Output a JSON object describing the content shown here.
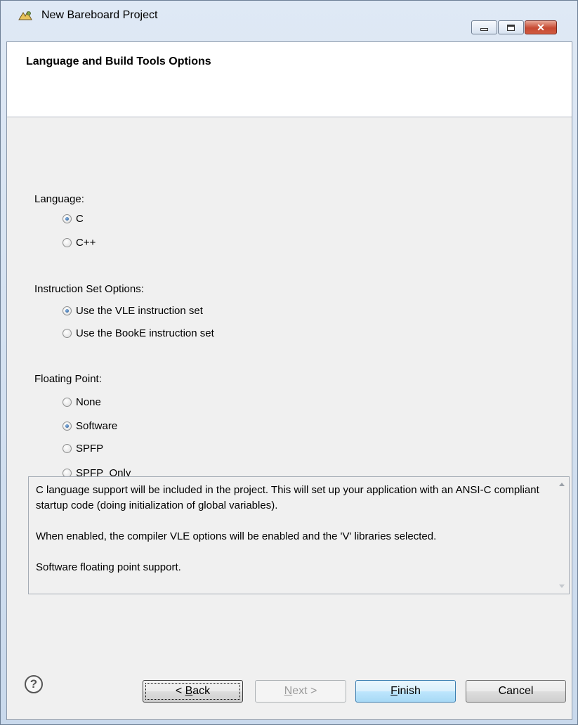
{
  "window": {
    "title": "New Bareboard Project",
    "app_icon": "wizard-icon",
    "controls": {
      "minimize": "minimize-icon",
      "maximize": "maximize-icon",
      "close": "close-icon"
    }
  },
  "header": {
    "title": "Language and Build Tools Options"
  },
  "language": {
    "label": "Language:",
    "options": [
      {
        "label": "C",
        "checked": true
      },
      {
        "label": "C++",
        "checked": false
      }
    ]
  },
  "instruction_set": {
    "label": "Instruction Set Options:",
    "options": [
      {
        "label": "Use the VLE instruction set",
        "checked": true
      },
      {
        "label": "Use the BookE instruction set",
        "checked": false
      }
    ]
  },
  "floating_point": {
    "label": "Floating Point:",
    "options": [
      {
        "label": "None",
        "checked": false
      },
      {
        "label": "Software",
        "checked": true
      },
      {
        "label": "SPFP",
        "checked": false
      },
      {
        "label": "SPFP_Only",
        "checked": false
      }
    ]
  },
  "description": {
    "paragraphs": [
      "C language support will be included in the project. This will set up your application with an ANSI-C compliant startup code (doing initialization of global variables).",
      "When enabled, the compiler VLE options will be enabled and the 'V' libraries selected.",
      "Software floating point support."
    ]
  },
  "buttons": {
    "help": "?",
    "back_prefix": "< ",
    "back_mnemonic": "B",
    "back_rest": "ack",
    "next_mnemonic": "N",
    "next_rest": "ext >",
    "finish_mnemonic": "F",
    "finish_rest": "inish",
    "cancel": "Cancel"
  }
}
